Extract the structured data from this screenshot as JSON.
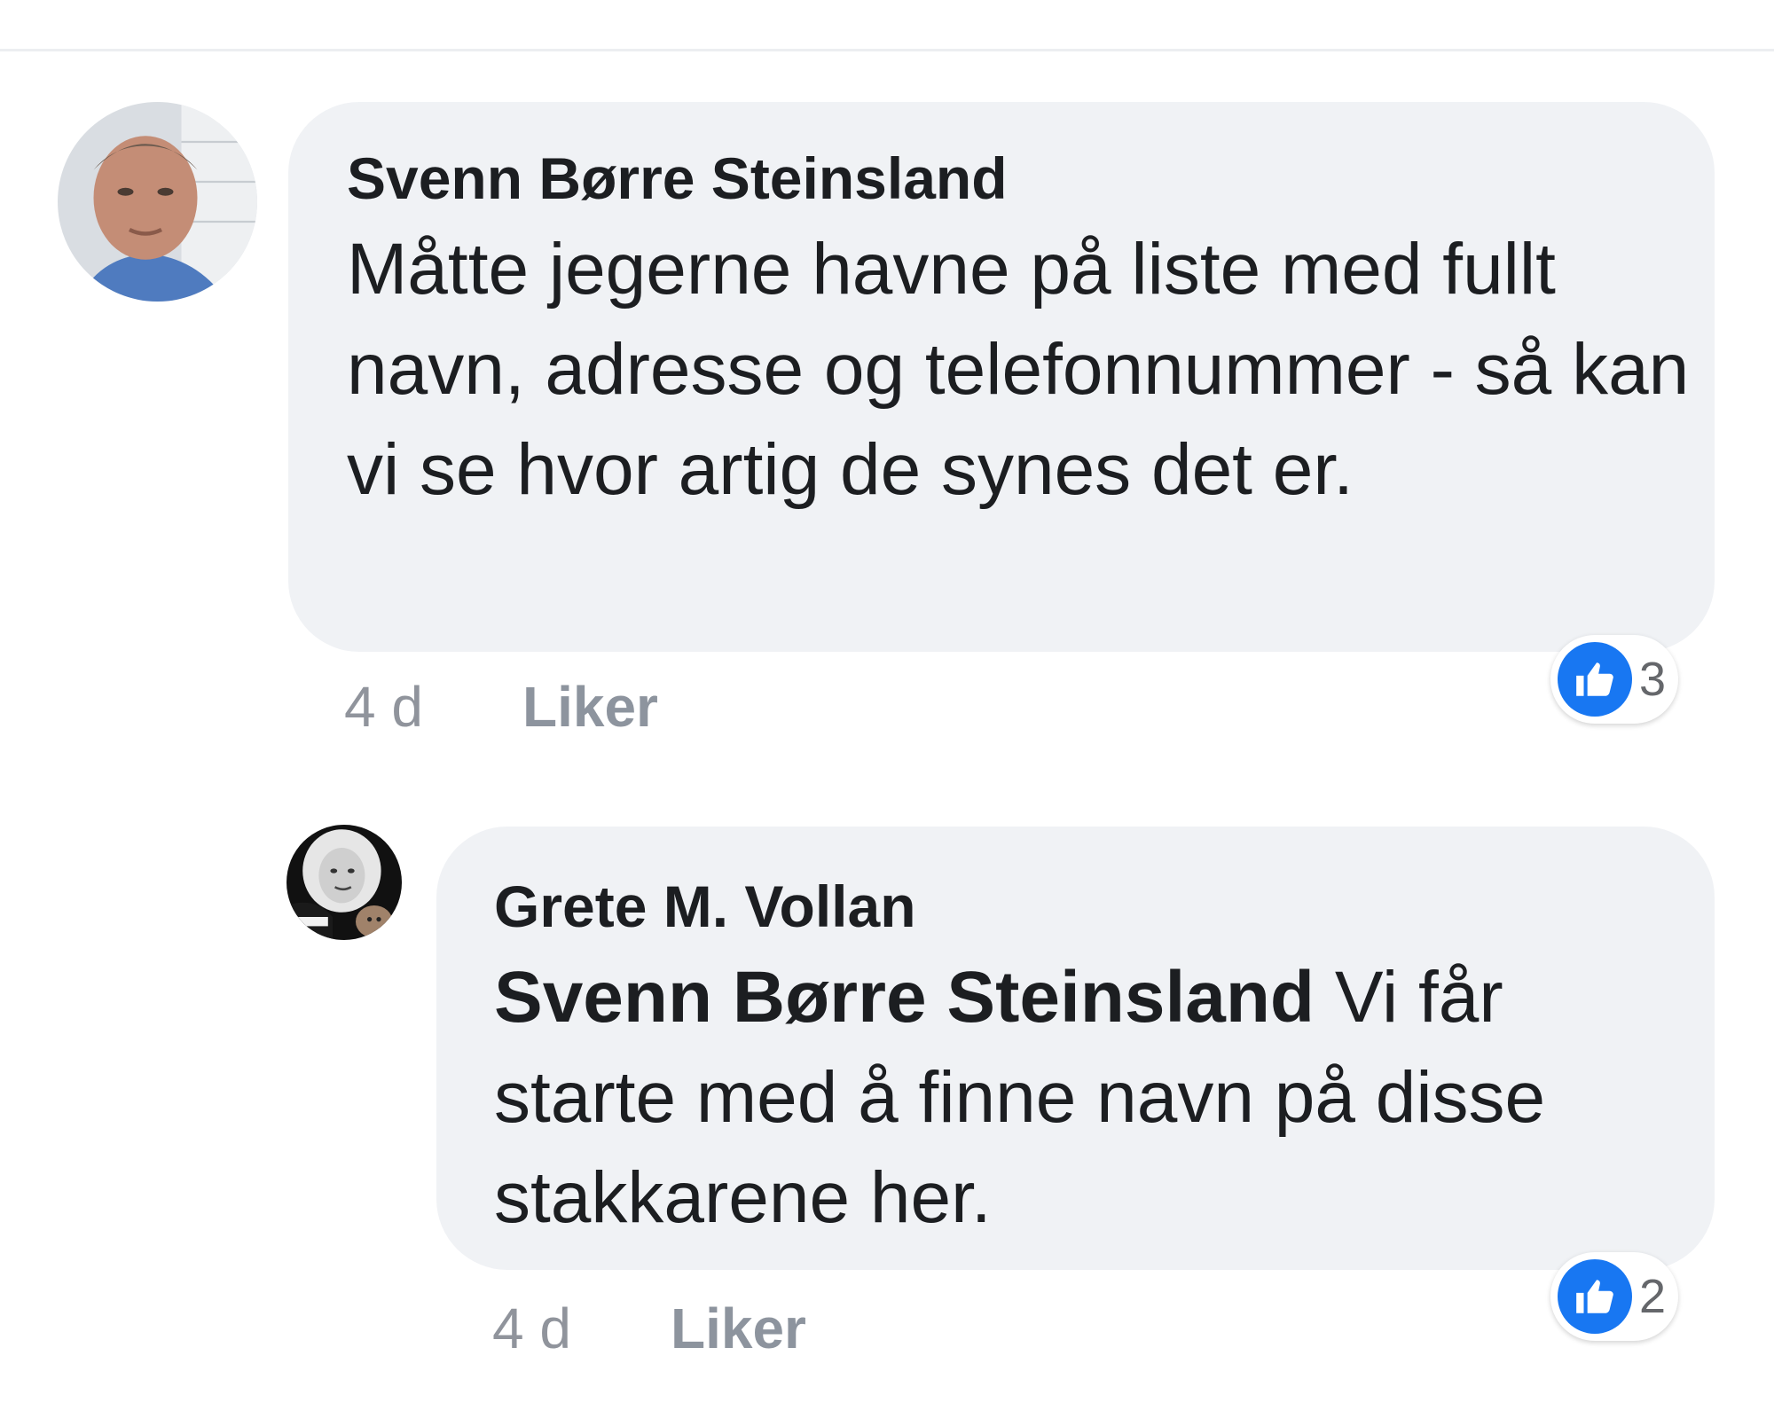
{
  "comments": [
    {
      "author": "Svenn Børre Steinsland",
      "text": "Måtte jegerne havne på liste med fullt navn, adresse og telefonnummer - så kan vi se hvor artig de synes det er.",
      "time": "4 d",
      "like_label": "Liker",
      "reaction_count": "3",
      "reaction_icon": "thumbs-up-icon"
    },
    {
      "author": "Grete M. Vollan",
      "mention": "Svenn Børre Steinsland",
      "text": " Vi får starte med å finne navn på disse stakkarene her.",
      "time": "4 d",
      "like_label": "Liker",
      "reaction_count": "2",
      "reaction_icon": "thumbs-up-icon"
    }
  ],
  "colors": {
    "bubble": "#f0f2f5",
    "like_blue": "#1877f2",
    "meta_gray": "#90949c"
  }
}
